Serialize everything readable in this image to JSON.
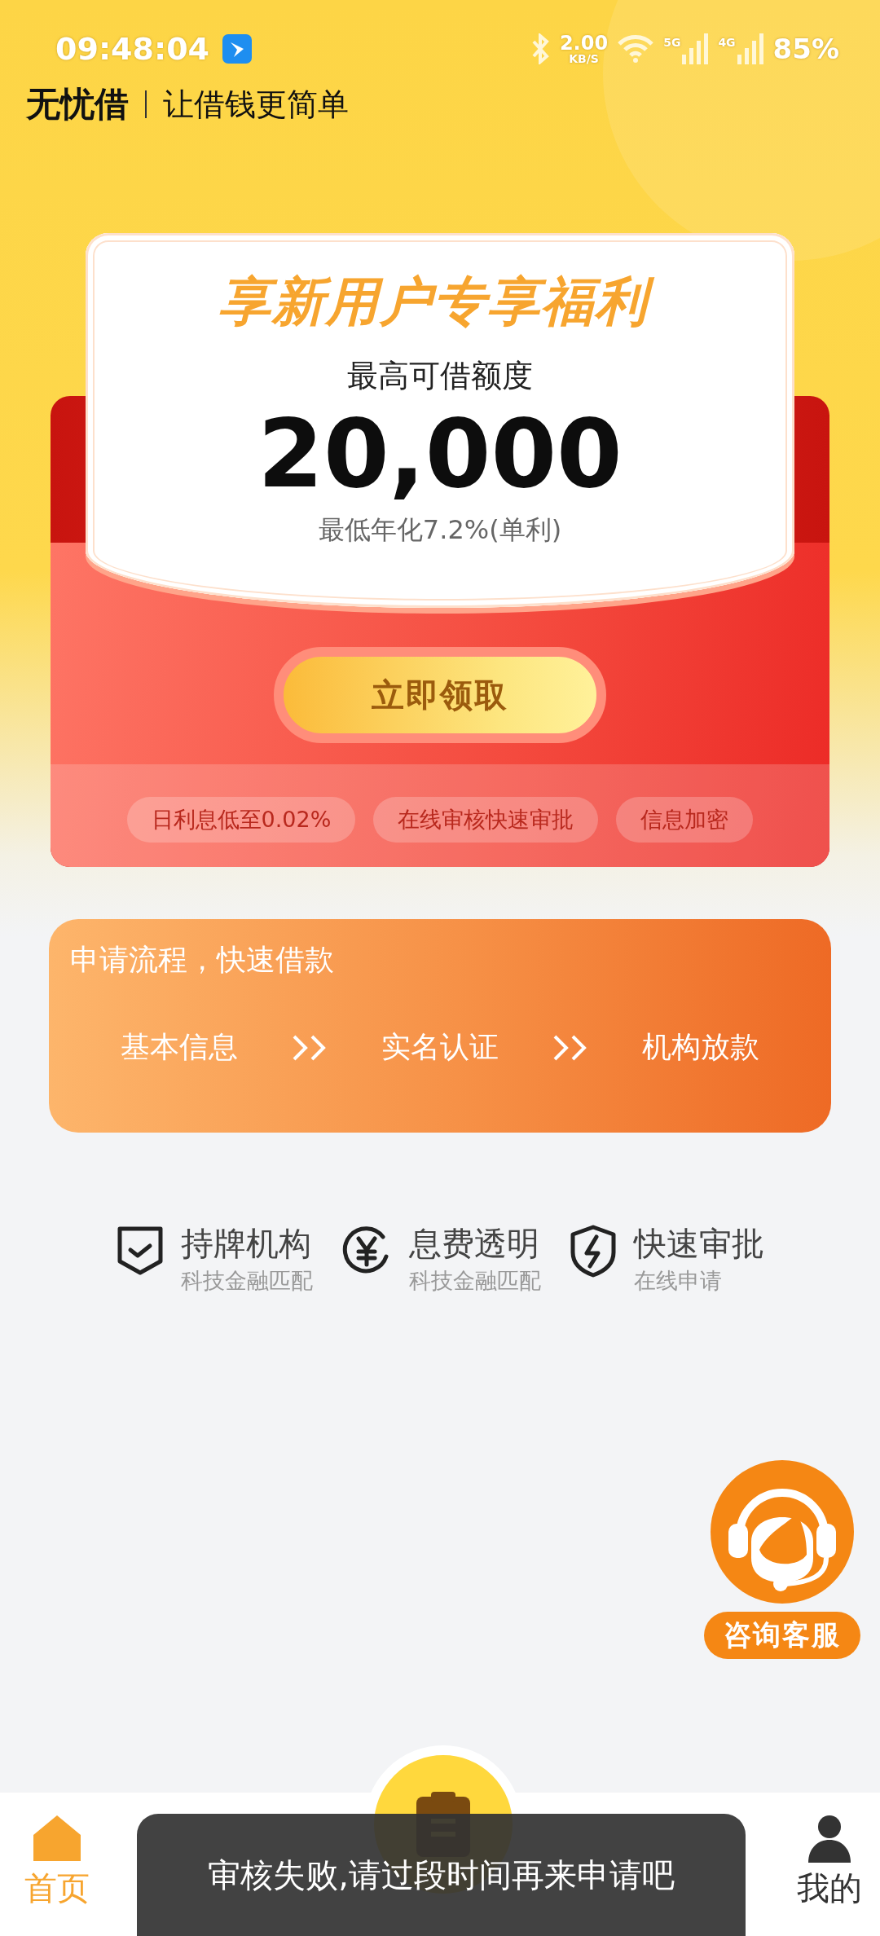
{
  "status_bar": {
    "time": "09:48:04",
    "speed": "2.00",
    "speed_unit": "KB/S",
    "sim1": "5G",
    "sim2": "4G",
    "battery": "85%"
  },
  "header": {
    "brand": "无忧借",
    "slogan": "让借钱更简单"
  },
  "offer": {
    "title": "享新用户专享福利",
    "subtitle": "最高可借额度",
    "amount": "20,000",
    "rate": "最低年化7.2%(单利)",
    "button": "立即领取",
    "tags": [
      "日利息低至0.02%",
      "在线审核快速审批",
      "信息加密"
    ]
  },
  "process": {
    "title": "申请流程，快速借款",
    "steps": [
      "基本信息",
      "实名认证",
      "机构放款"
    ]
  },
  "features": [
    {
      "kind": "shield-check",
      "title": "持牌机构",
      "subtitle": "科技金融匹配"
    },
    {
      "kind": "yen",
      "title": "息费透明",
      "subtitle": "科技金融匹配"
    },
    {
      "kind": "shield-bolt",
      "title": "快速审批",
      "subtitle": "在线申请"
    }
  ],
  "support": {
    "label": "咨询客服"
  },
  "nav": {
    "tabs": [
      {
        "kind": "home",
        "label": "首页",
        "selected": true
      },
      {
        "kind": "mine",
        "label": "我的",
        "selected": false
      }
    ]
  },
  "toast": {
    "text": "审核失败,请过段时间再来申请吧"
  }
}
